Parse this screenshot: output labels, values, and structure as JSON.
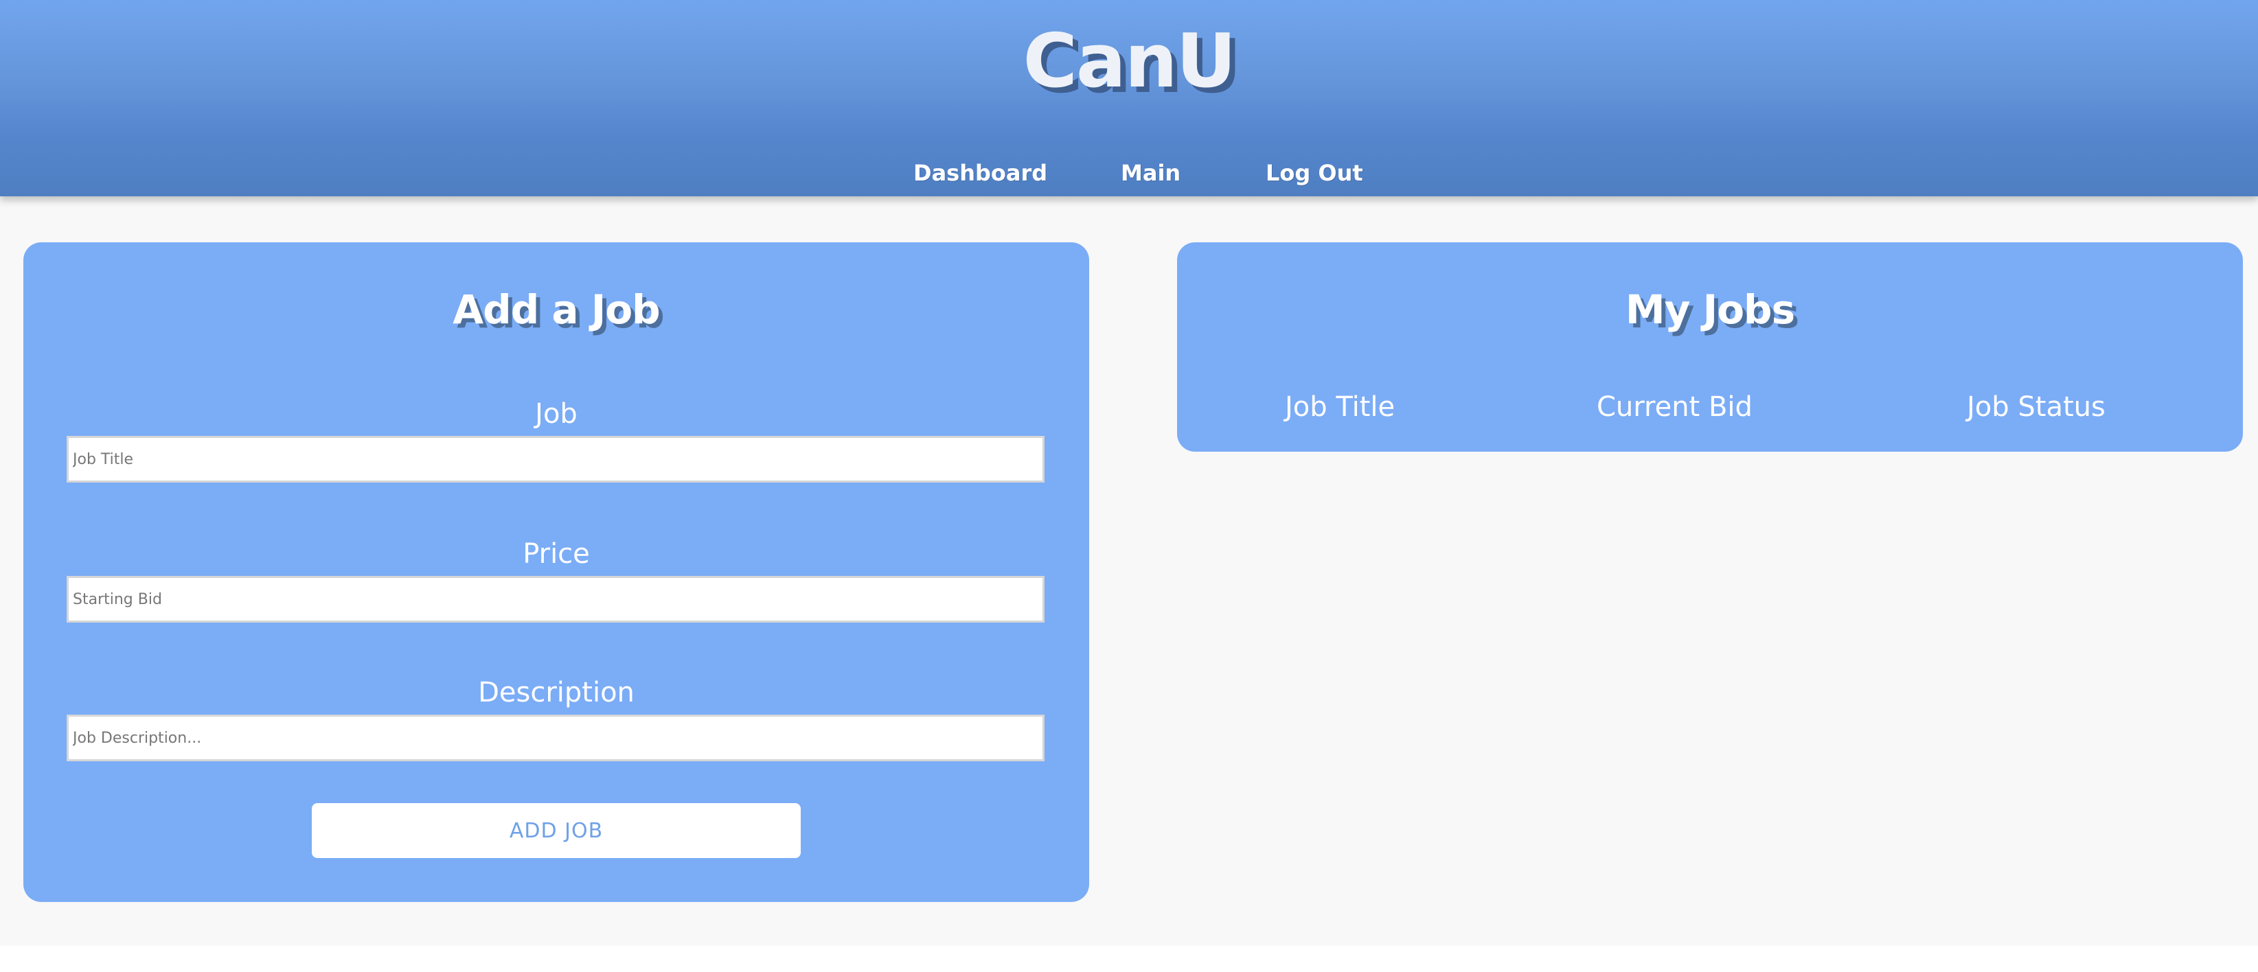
{
  "header": {
    "brand": "CanU",
    "nav": [
      {
        "label": "Dashboard"
      },
      {
        "label": "Main"
      },
      {
        "label": "Log Out"
      }
    ]
  },
  "add_job": {
    "title": "Add a Job",
    "fields": [
      {
        "label": "Job",
        "placeholder": "Job Title",
        "value": ""
      },
      {
        "label": "Price",
        "placeholder": "Starting Bid",
        "value": ""
      },
      {
        "label": "Description",
        "placeholder": "Job Description...",
        "value": ""
      }
    ],
    "submit_label": "ADD JOB"
  },
  "my_jobs": {
    "title": "My Jobs",
    "columns": [
      "Job Title",
      "Current Bid",
      "Job Status"
    ],
    "rows": []
  },
  "colors": {
    "header_top": "#71a5ed",
    "header_bottom": "#4f7fc2",
    "card": "#7bacf6",
    "page_bg": "#f8f8f8",
    "button_text": "#6fa1e8"
  }
}
